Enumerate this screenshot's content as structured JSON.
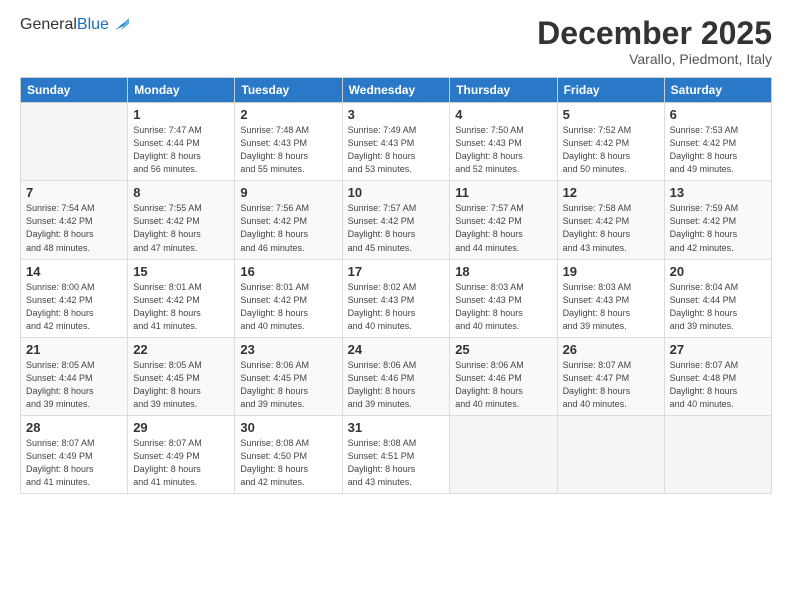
{
  "logo": {
    "general": "General",
    "blue": "Blue"
  },
  "header": {
    "title": "December 2025",
    "subtitle": "Varallo, Piedmont, Italy"
  },
  "days_of_week": [
    "Sunday",
    "Monday",
    "Tuesday",
    "Wednesday",
    "Thursday",
    "Friday",
    "Saturday"
  ],
  "weeks": [
    [
      {
        "day": "",
        "info": ""
      },
      {
        "day": "1",
        "info": "Sunrise: 7:47 AM\nSunset: 4:44 PM\nDaylight: 8 hours\nand 56 minutes."
      },
      {
        "day": "2",
        "info": "Sunrise: 7:48 AM\nSunset: 4:43 PM\nDaylight: 8 hours\nand 55 minutes."
      },
      {
        "day": "3",
        "info": "Sunrise: 7:49 AM\nSunset: 4:43 PM\nDaylight: 8 hours\nand 53 minutes."
      },
      {
        "day": "4",
        "info": "Sunrise: 7:50 AM\nSunset: 4:43 PM\nDaylight: 8 hours\nand 52 minutes."
      },
      {
        "day": "5",
        "info": "Sunrise: 7:52 AM\nSunset: 4:42 PM\nDaylight: 8 hours\nand 50 minutes."
      },
      {
        "day": "6",
        "info": "Sunrise: 7:53 AM\nSunset: 4:42 PM\nDaylight: 8 hours\nand 49 minutes."
      }
    ],
    [
      {
        "day": "7",
        "info": "Sunrise: 7:54 AM\nSunset: 4:42 PM\nDaylight: 8 hours\nand 48 minutes."
      },
      {
        "day": "8",
        "info": "Sunrise: 7:55 AM\nSunset: 4:42 PM\nDaylight: 8 hours\nand 47 minutes."
      },
      {
        "day": "9",
        "info": "Sunrise: 7:56 AM\nSunset: 4:42 PM\nDaylight: 8 hours\nand 46 minutes."
      },
      {
        "day": "10",
        "info": "Sunrise: 7:57 AM\nSunset: 4:42 PM\nDaylight: 8 hours\nand 45 minutes."
      },
      {
        "day": "11",
        "info": "Sunrise: 7:57 AM\nSunset: 4:42 PM\nDaylight: 8 hours\nand 44 minutes."
      },
      {
        "day": "12",
        "info": "Sunrise: 7:58 AM\nSunset: 4:42 PM\nDaylight: 8 hours\nand 43 minutes."
      },
      {
        "day": "13",
        "info": "Sunrise: 7:59 AM\nSunset: 4:42 PM\nDaylight: 8 hours\nand 42 minutes."
      }
    ],
    [
      {
        "day": "14",
        "info": "Sunrise: 8:00 AM\nSunset: 4:42 PM\nDaylight: 8 hours\nand 42 minutes."
      },
      {
        "day": "15",
        "info": "Sunrise: 8:01 AM\nSunset: 4:42 PM\nDaylight: 8 hours\nand 41 minutes."
      },
      {
        "day": "16",
        "info": "Sunrise: 8:01 AM\nSunset: 4:42 PM\nDaylight: 8 hours\nand 40 minutes."
      },
      {
        "day": "17",
        "info": "Sunrise: 8:02 AM\nSunset: 4:43 PM\nDaylight: 8 hours\nand 40 minutes."
      },
      {
        "day": "18",
        "info": "Sunrise: 8:03 AM\nSunset: 4:43 PM\nDaylight: 8 hours\nand 40 minutes."
      },
      {
        "day": "19",
        "info": "Sunrise: 8:03 AM\nSunset: 4:43 PM\nDaylight: 8 hours\nand 39 minutes."
      },
      {
        "day": "20",
        "info": "Sunrise: 8:04 AM\nSunset: 4:44 PM\nDaylight: 8 hours\nand 39 minutes."
      }
    ],
    [
      {
        "day": "21",
        "info": "Sunrise: 8:05 AM\nSunset: 4:44 PM\nDaylight: 8 hours\nand 39 minutes."
      },
      {
        "day": "22",
        "info": "Sunrise: 8:05 AM\nSunset: 4:45 PM\nDaylight: 8 hours\nand 39 minutes."
      },
      {
        "day": "23",
        "info": "Sunrise: 8:06 AM\nSunset: 4:45 PM\nDaylight: 8 hours\nand 39 minutes."
      },
      {
        "day": "24",
        "info": "Sunrise: 8:06 AM\nSunset: 4:46 PM\nDaylight: 8 hours\nand 39 minutes."
      },
      {
        "day": "25",
        "info": "Sunrise: 8:06 AM\nSunset: 4:46 PM\nDaylight: 8 hours\nand 40 minutes."
      },
      {
        "day": "26",
        "info": "Sunrise: 8:07 AM\nSunset: 4:47 PM\nDaylight: 8 hours\nand 40 minutes."
      },
      {
        "day": "27",
        "info": "Sunrise: 8:07 AM\nSunset: 4:48 PM\nDaylight: 8 hours\nand 40 minutes."
      }
    ],
    [
      {
        "day": "28",
        "info": "Sunrise: 8:07 AM\nSunset: 4:49 PM\nDaylight: 8 hours\nand 41 minutes."
      },
      {
        "day": "29",
        "info": "Sunrise: 8:07 AM\nSunset: 4:49 PM\nDaylight: 8 hours\nand 41 minutes."
      },
      {
        "day": "30",
        "info": "Sunrise: 8:08 AM\nSunset: 4:50 PM\nDaylight: 8 hours\nand 42 minutes."
      },
      {
        "day": "31",
        "info": "Sunrise: 8:08 AM\nSunset: 4:51 PM\nDaylight: 8 hours\nand 43 minutes."
      },
      {
        "day": "",
        "info": ""
      },
      {
        "day": "",
        "info": ""
      },
      {
        "day": "",
        "info": ""
      }
    ]
  ]
}
